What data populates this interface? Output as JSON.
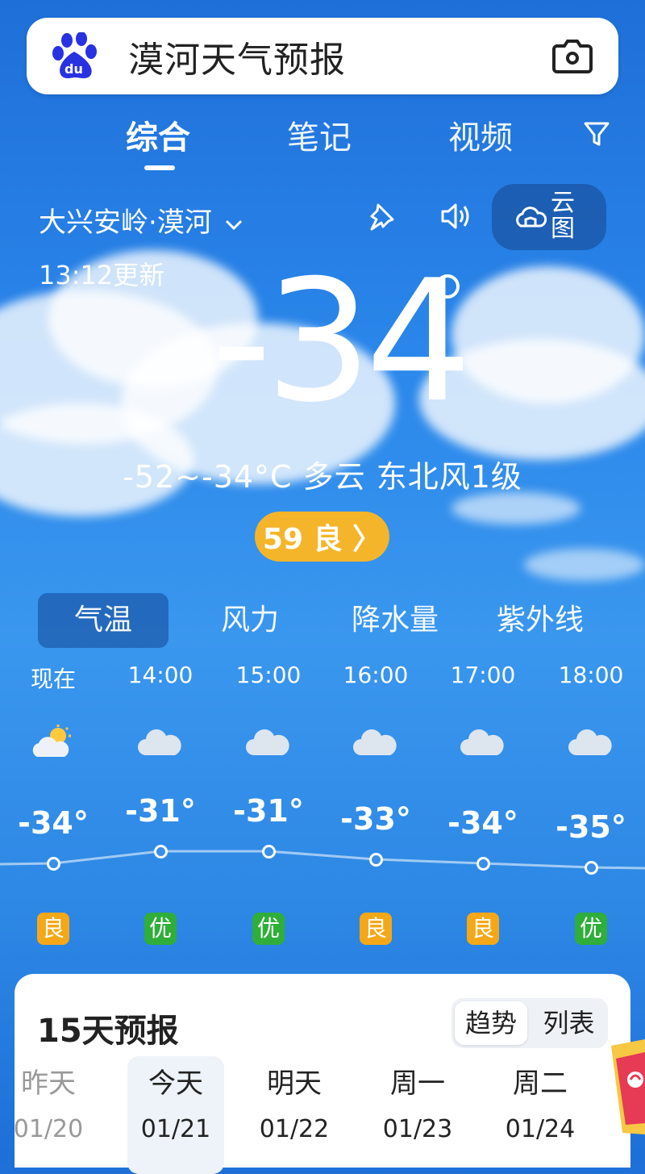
{
  "search": {
    "query": "漠河天气预报"
  },
  "tabs": [
    {
      "label": "综合",
      "active": true
    },
    {
      "label": "笔记",
      "active": false
    },
    {
      "label": "视频",
      "active": false
    }
  ],
  "location": {
    "name": "大兴安岭·漠河"
  },
  "cloud_map": {
    "label": "云图"
  },
  "weather": {
    "updated": "13:12更新",
    "current_temp": "-34",
    "summary": "-52~-34°C 多云 东北风1级",
    "aqi_label": "59 良 〉",
    "aqi_value": 59,
    "aqi_level": "良",
    "aqi_color": "#f4b52a"
  },
  "metric_tabs": [
    {
      "label": "气温",
      "active": true
    },
    {
      "label": "风力",
      "active": false
    },
    {
      "label": "降水量",
      "active": false
    },
    {
      "label": "紫外线",
      "active": false
    }
  ],
  "hourly": [
    {
      "time": "现在",
      "icon": "partly-cloudy-sun-icon",
      "temp": "-34°",
      "temp_value": -34,
      "air": "良",
      "air_color": "#f4a818"
    },
    {
      "time": "14:00",
      "icon": "cloud-icon",
      "temp": "-31°",
      "temp_value": -31,
      "air": "优",
      "air_color": "#2fae3a"
    },
    {
      "time": "15:00",
      "icon": "cloud-icon",
      "temp": "-31°",
      "temp_value": -31,
      "air": "优",
      "air_color": "#2fae3a"
    },
    {
      "time": "16:00",
      "icon": "cloud-icon",
      "temp": "-33°",
      "temp_value": -33,
      "air": "良",
      "air_color": "#f4a818"
    },
    {
      "time": "17:00",
      "icon": "cloud-icon",
      "temp": "-34°",
      "temp_value": -34,
      "air": "良",
      "air_color": "#f4a818"
    },
    {
      "time": "18:00",
      "icon": "cloud-icon",
      "temp": "-35°",
      "temp_value": -35,
      "air": "优",
      "air_color": "#2fae3a"
    }
  ],
  "forecast": {
    "title": "15天预报",
    "view_options": [
      {
        "label": "趋势",
        "active": true
      },
      {
        "label": "列表",
        "active": false
      }
    ],
    "days": [
      {
        "name": "昨天",
        "date": "01/20",
        "past": true
      },
      {
        "name": "今天",
        "date": "01/21",
        "today": true
      },
      {
        "name": "明天",
        "date": "01/22"
      },
      {
        "name": "周一",
        "date": "01/23"
      },
      {
        "name": "周二",
        "date": "01/24"
      }
    ]
  }
}
